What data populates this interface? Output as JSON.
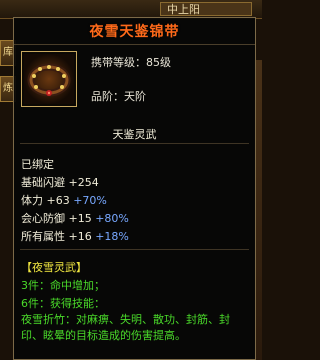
{
  "background": {
    "top_tab": "中上阳",
    "left_buttons": [
      "库",
      "炼"
    ]
  },
  "item": {
    "name": "夜雪天鉴锦带",
    "level_req": "携带等级：85级",
    "tier": "品阶：天阶",
    "set_title": "天鉴灵武",
    "icon": "belt-icon"
  },
  "stats": {
    "bound": "已绑定",
    "dodge_label": "基础闪避",
    "dodge_value": "+254",
    "phys_label": "体力",
    "phys_value": "+63",
    "phys_bonus": "+70%",
    "crit_label": "会心防御",
    "crit_value": "+15",
    "crit_bonus": "+80%",
    "all_label": "所有属性",
    "all_value": "+16",
    "all_bonus": "+18%"
  },
  "set": {
    "header": "【夜雪灵武】",
    "piece3": "3件：命中增加；",
    "piece6": "6件：获得技能：",
    "skill": "夜雪折竹：对麻痹、失明、散功、封筋、封印、眩晕的目标造成的伤害提高。"
  },
  "colors": {
    "title": "#ff6a1a",
    "green": "#4ad92a",
    "blue": "#78a8ff",
    "yellow": "#f0e640"
  }
}
